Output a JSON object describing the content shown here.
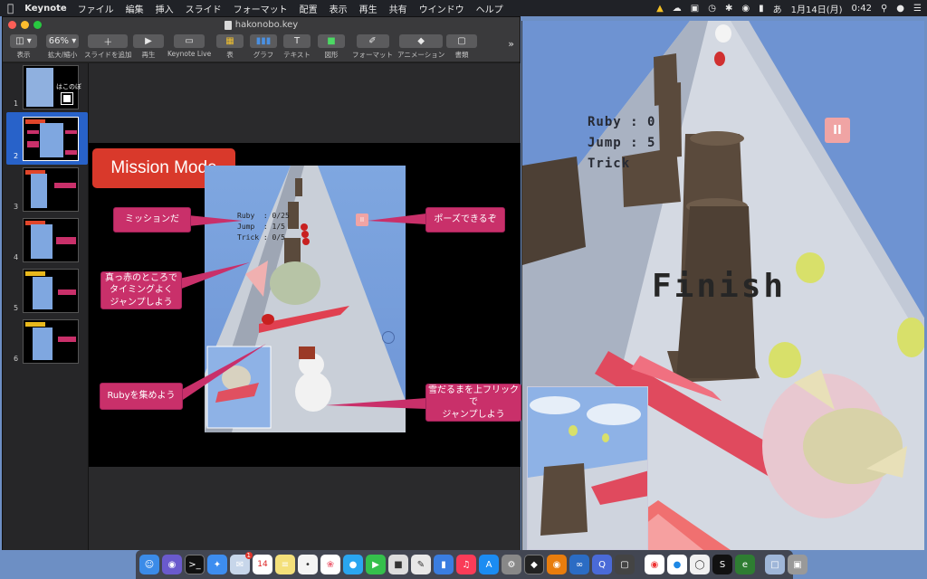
{
  "menubar": {
    "apple": "",
    "app_name": "Keynote",
    "menus": [
      "ファイル",
      "編集",
      "挿入",
      "スライド",
      "フォーマット",
      "配置",
      "表示",
      "再生",
      "共有",
      "ウインドウ",
      "ヘルプ"
    ],
    "date": "1月14日(月)",
    "time": "0:42"
  },
  "keynote": {
    "title": "hakonobo.key",
    "toolbar": {
      "view": "表示",
      "zoom_value": "66%",
      "zoom": "拡大/縮小",
      "add_slide": "スライドを追加",
      "play": "再生",
      "live": "Keynote Live",
      "table": "表",
      "chart": "グラフ",
      "text": "テキスト",
      "shape": "図形",
      "format": "フォーマット",
      "animate": "アニメーション",
      "document": "書類"
    },
    "slides": [
      {
        "num": "1",
        "tag": "",
        "label": "はこのぼ"
      },
      {
        "num": "2",
        "tag": "Mission Mode",
        "label": ""
      },
      {
        "num": "3",
        "tag": "Mission Mode",
        "label": ""
      },
      {
        "num": "4",
        "tag": "Mission Mode",
        "label": ""
      },
      {
        "num": "5",
        "tag": "Trick Mode",
        "label": ""
      },
      {
        "num": "6",
        "tag": "Trick Mode",
        "label": ""
      }
    ],
    "current_slide": {
      "title": "Mission Mode",
      "callouts": {
        "mission": "ミッションだ",
        "pause": "ポーズできるぞ",
        "timing_1": "真っ赤のところで",
        "timing_2": "タイミングよく",
        "timing_3": "ジャンプしよう",
        "ruby": "Rubyを集めよう",
        "snowman_1": "雪だるまを上フリックで",
        "snowman_2": "ジャンプしよう"
      },
      "hud": {
        "ruby": "Ruby  : 0/25",
        "jump": "Jump  : 1/5",
        "trick": "Trick : 0/5"
      }
    }
  },
  "game": {
    "hud": {
      "ruby": "Ruby  : 0",
      "jump": "Jump  : 5",
      "trick": "Trick"
    },
    "finish": "Finish",
    "pause": "II"
  },
  "dock": {
    "calendar_day": "14",
    "mail_badge": "1"
  },
  "colors": {
    "callout": "#c9306a",
    "title_tag": "#d9392b",
    "selection": "#2862c9",
    "sky": "#6e93d2"
  }
}
